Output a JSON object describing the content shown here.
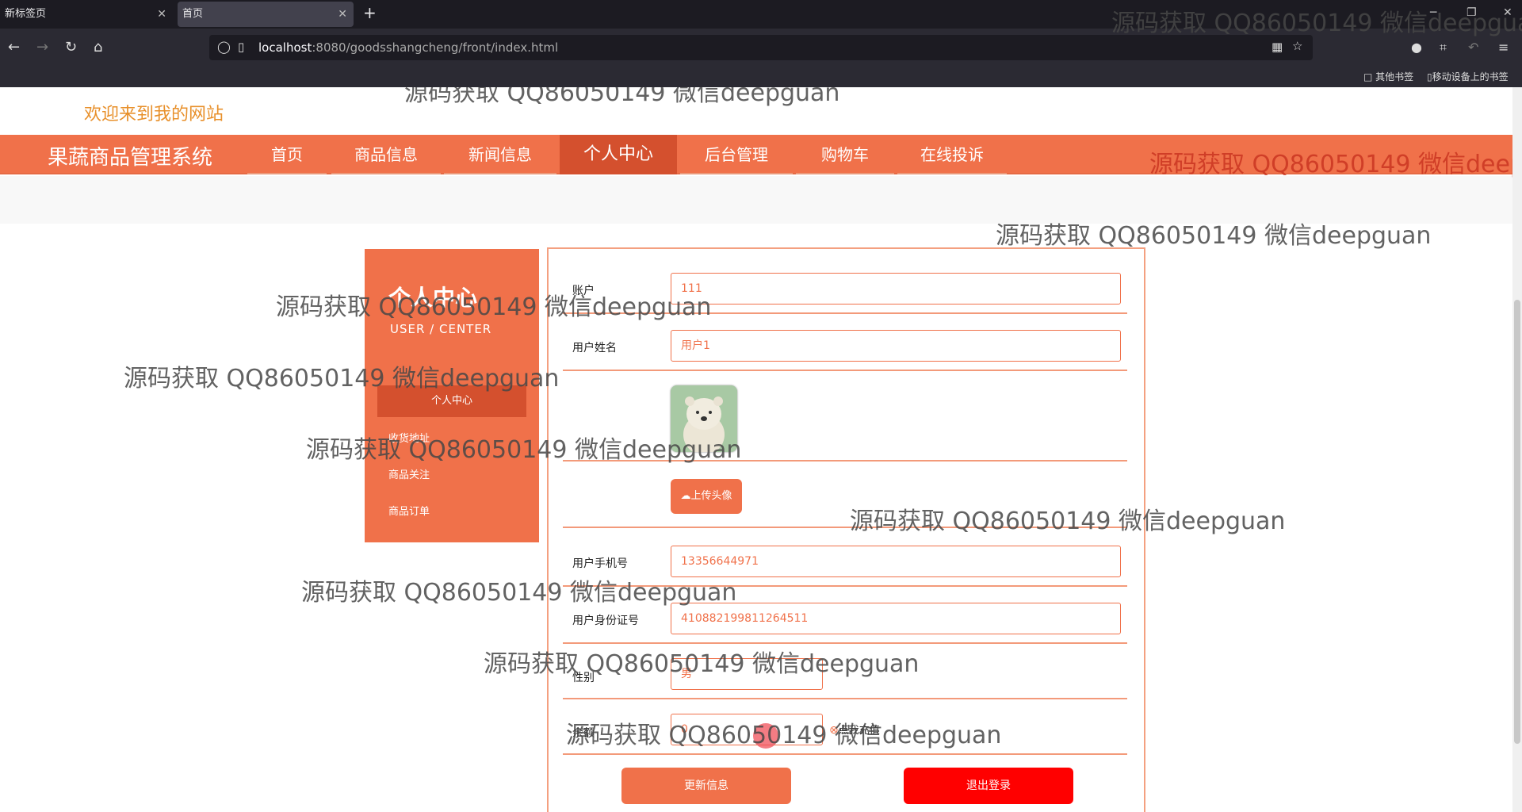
{
  "browser": {
    "tabs": [
      {
        "label": "新标签页",
        "active": false
      },
      {
        "label": "首页",
        "active": true
      }
    ],
    "url_host": "localhost",
    "url_rest": ":8080/goodsshangcheng/front/index.html",
    "bookmarks": [
      "其他书签",
      "移动设备上的书签"
    ]
  },
  "site": {
    "welcome": "欢迎来到我的网站",
    "brand": "果蔬商品管理系统",
    "menu": [
      {
        "label": "首页",
        "active": false
      },
      {
        "label": "商品信息",
        "active": false
      },
      {
        "label": "新闻信息",
        "active": false
      },
      {
        "label": "个人中心",
        "active": true
      },
      {
        "label": "后台管理",
        "active": false
      },
      {
        "label": "购物车",
        "active": false
      },
      {
        "label": "在线投诉",
        "active": false
      }
    ]
  },
  "sidebar": {
    "title": "个人中心",
    "subtitle": "USER / CENTER",
    "items": [
      {
        "label": "个人中心",
        "active": true
      },
      {
        "label": "收货地址",
        "active": false
      },
      {
        "label": "商品关注",
        "active": false
      },
      {
        "label": "商品订单",
        "active": false
      }
    ]
  },
  "form": {
    "account_label": "账户",
    "account_value": "111",
    "name_label": "用户姓名",
    "name_value": "用户1",
    "upload_label": "上传头像",
    "phone_label": "用户手机号",
    "phone_value": "13356644971",
    "idcard_label": "用户身份证号",
    "idcard_value": "410882199811264511",
    "gender_label": "性别",
    "gender_value": "男",
    "balance_label": "余额",
    "balance_value": "0",
    "recharge_label": "点我充值",
    "update_button": "更新信息",
    "logout_button": "退出登录"
  },
  "watermark": "源码获取 QQ86050149 微信deepguan",
  "colors": {
    "accent": "#f0714a",
    "accent_dark": "#d4502e",
    "logout": "#ff0000",
    "welcome": "#e8902b"
  }
}
